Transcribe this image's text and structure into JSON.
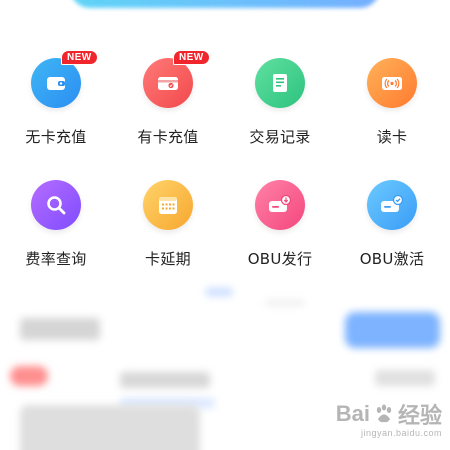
{
  "grid": {
    "items": [
      {
        "label": "无卡充值",
        "icon": "wallet-icon",
        "badge": "NEW",
        "color_from": "#3fb6f5",
        "color_to": "#2b8ef2"
      },
      {
        "label": "有卡充值",
        "icon": "card-icon",
        "badge": "NEW",
        "color_from": "#ff7a78",
        "color_to": "#f2494c"
      },
      {
        "label": "交易记录",
        "icon": "document-icon",
        "badge": "",
        "color_from": "#5fe0a0",
        "color_to": "#2ec27e"
      },
      {
        "label": "读卡",
        "icon": "nfc-read-icon",
        "badge": "",
        "color_from": "#ffb259",
        "color_to": "#ff7a2f"
      },
      {
        "label": "费率查询",
        "icon": "search-icon",
        "badge": "",
        "color_from": "#b56cff",
        "color_to": "#7f4dff"
      },
      {
        "label": "卡延期",
        "icon": "calendar-icon",
        "badge": "",
        "color_from": "#ffd36a",
        "color_to": "#f7a72f"
      },
      {
        "label": "OBU发行",
        "icon": "obu-issue-icon",
        "badge": "",
        "color_from": "#ff82a8",
        "color_to": "#f4477d"
      },
      {
        "label": "OBU激活",
        "icon": "obu-activate-icon",
        "badge": "",
        "color_from": "#6ccaff",
        "color_to": "#3a9cf6"
      }
    ]
  },
  "watermark": {
    "brand": "Bai",
    "brand_tail": "经验",
    "url": "jingyan.baidu.com"
  }
}
